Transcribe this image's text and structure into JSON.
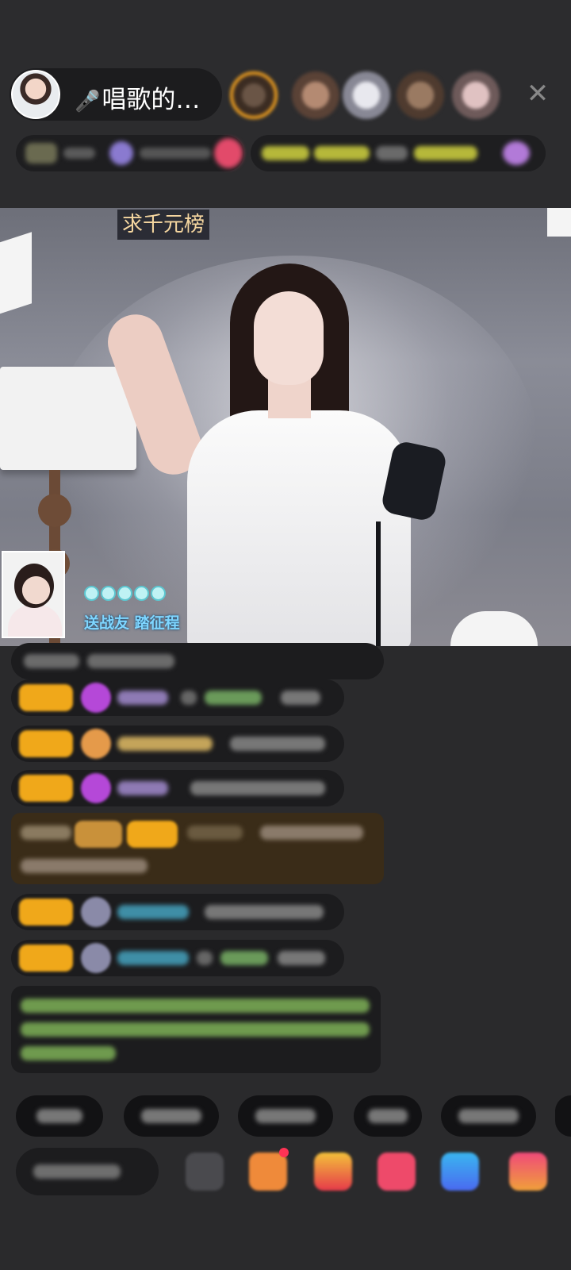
{
  "header": {
    "host_name": "唱歌的…",
    "host_prefix_icon": "microphone-icon",
    "close_icon": "close-icon",
    "viewer_avatars": [
      {
        "colors": "#4d3a2c",
        "rank_frame": true
      },
      {
        "colors": "#8d6b5a",
        "rank_frame": false
      },
      {
        "colors": "#b9b9c4",
        "rank_frame": false
      },
      {
        "colors": "#7a5f4c",
        "rank_frame": false
      },
      {
        "colors": "#c7a7a7",
        "rank_frame": false
      }
    ]
  },
  "video": {
    "sign_text": "求千元榜",
    "caption": "送战友 踏征程"
  },
  "colors": {
    "accent_gold": "#f0a81a",
    "chat_bubble": "#1c1c1e",
    "background": "#2a2a2c"
  }
}
